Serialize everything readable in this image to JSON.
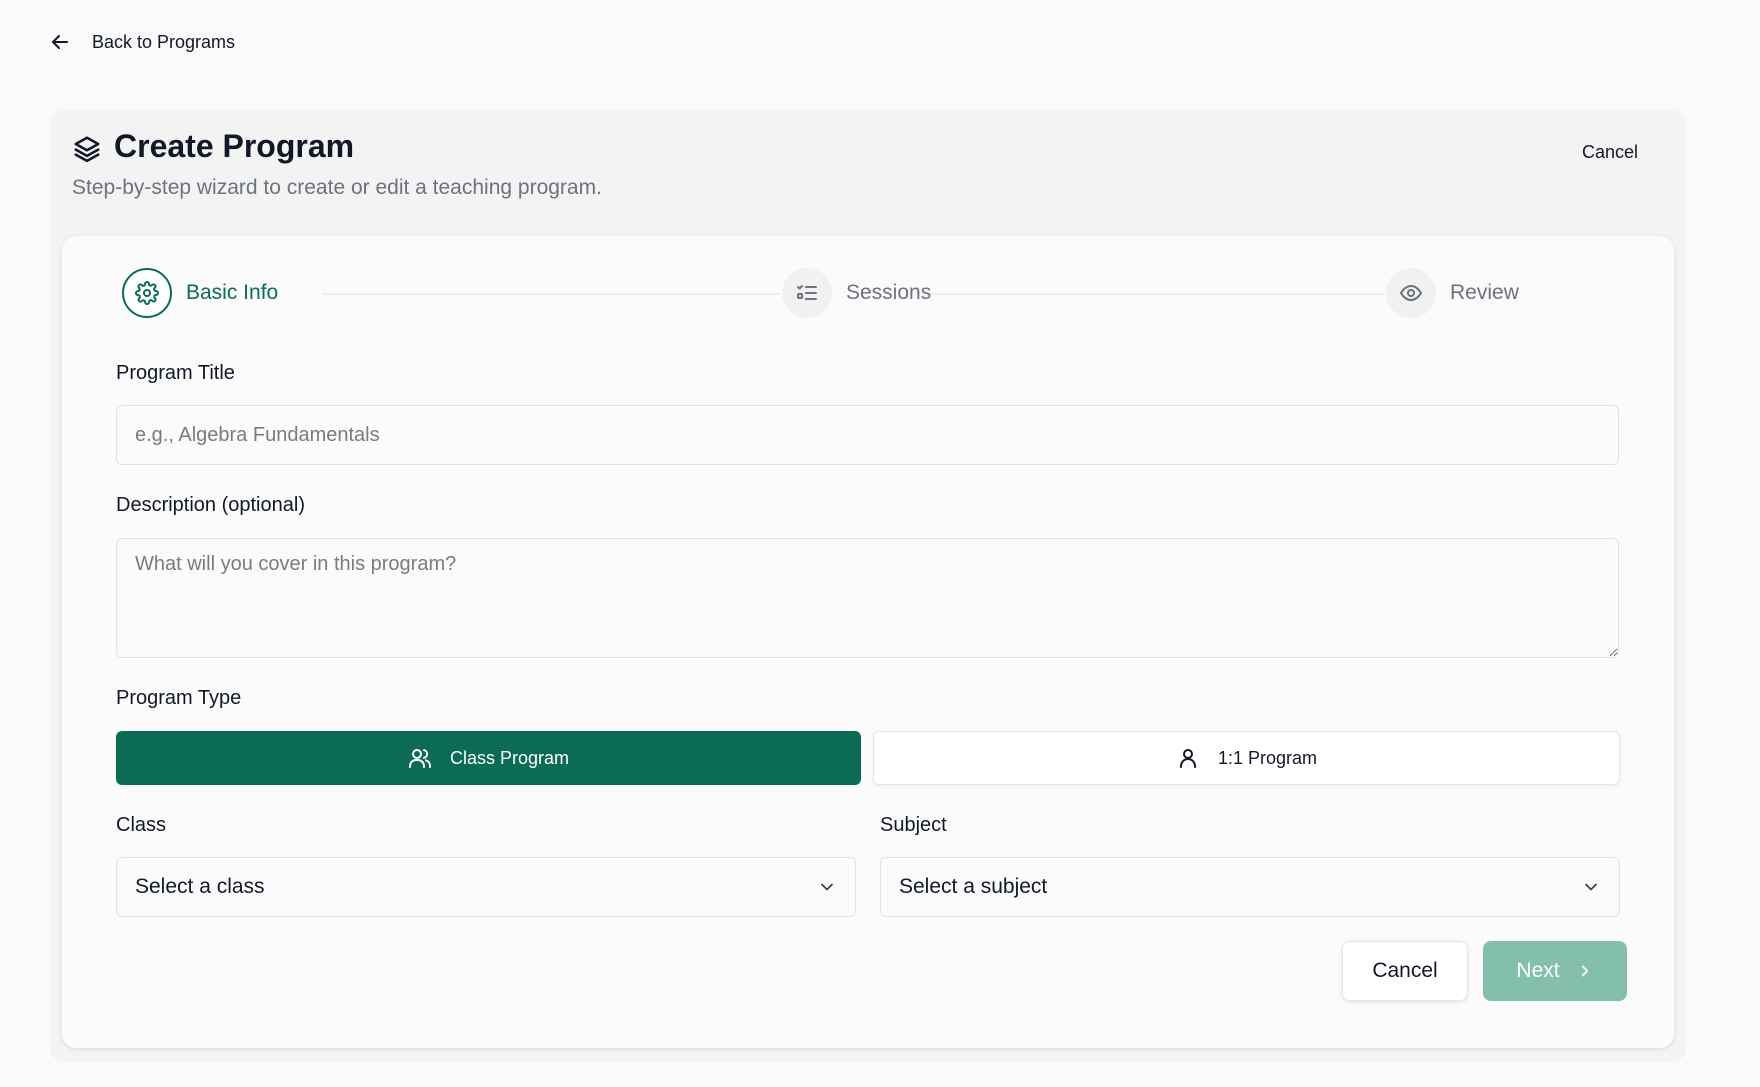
{
  "nav": {
    "back_label": "Back to Programs"
  },
  "header": {
    "title": "Create Program",
    "subtitle": "Step-by-step wizard to create or edit a teaching program.",
    "cancel_label": "Cancel"
  },
  "stepper": {
    "steps": [
      {
        "label": "Basic Info",
        "icon": "gear-icon",
        "state": "active"
      },
      {
        "label": "Sessions",
        "icon": "list-checks-icon",
        "state": "inactive"
      },
      {
        "label": "Review",
        "icon": "eye-icon",
        "state": "inactive"
      }
    ]
  },
  "form": {
    "title_label": "Program Title",
    "title_placeholder": "e.g., Algebra Fundamentals",
    "title_value": "",
    "description_label": "Description (optional)",
    "description_placeholder": "What will you cover in this program?",
    "description_value": "",
    "type_label": "Program Type",
    "types": [
      {
        "label": "Class Program",
        "icon": "users-icon",
        "selected": true
      },
      {
        "label": "1:1 Program",
        "icon": "user-icon",
        "selected": false
      }
    ],
    "class_label": "Class",
    "class_value": "Select a class",
    "subject_label": "Subject",
    "subject_value": "Select a subject"
  },
  "actions": {
    "cancel_label": "Cancel",
    "next_label": "Next"
  },
  "colors": {
    "primary": "#0b6b55",
    "primary_disabled": "#84bfae",
    "muted_text": "#6b7280"
  }
}
